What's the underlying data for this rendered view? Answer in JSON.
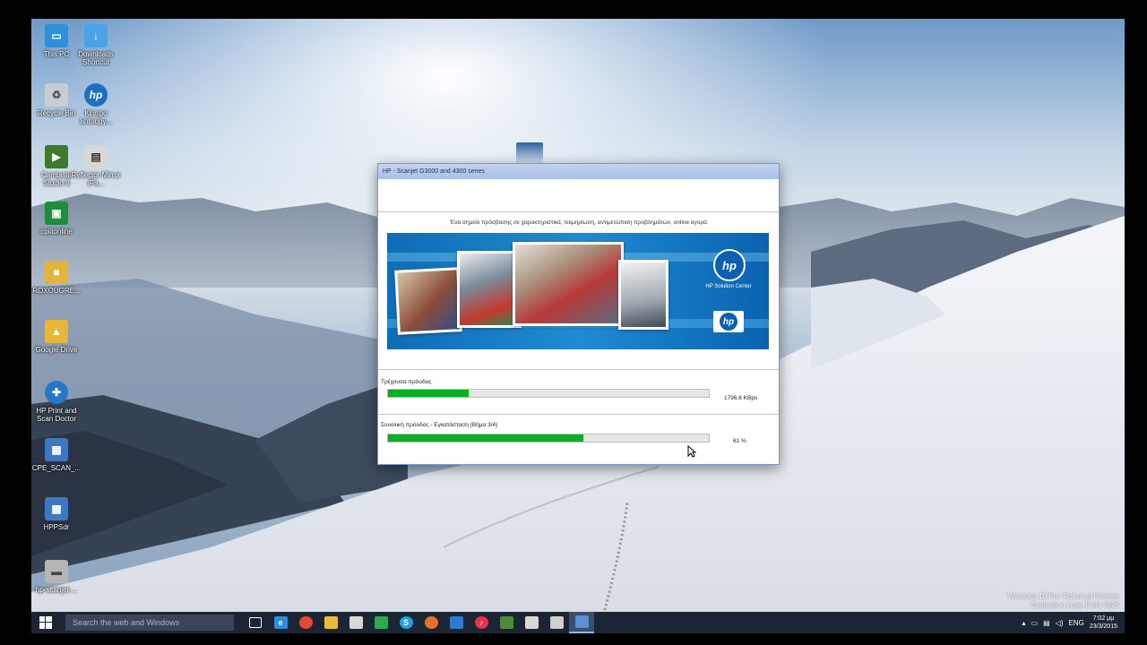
{
  "desktop": {
    "icons": [
      {
        "label": "This PC",
        "glyph": "pc-icon",
        "color": "#2f8fd8"
      },
      {
        "label": "Downloads Shortcut",
        "glyph": "downloads-shortcut-icon",
        "color": "#4aa3e8"
      },
      {
        "label": "Recycle Bin",
        "glyph": "recycle-bin-icon",
        "color": "#c8ccd3"
      },
      {
        "label": "Κέντρο λειτουργ...",
        "glyph": "hp-icon",
        "color": "#1f6fc0"
      },
      {
        "label": "Camtasia Studio 8",
        "glyph": "camtasia-icon",
        "color": "#3d7a2c"
      },
      {
        "label": "Reflector Mirror iPa...",
        "glyph": "reflector-icon",
        "color": "#d8d8d8"
      },
      {
        "label": "cpiitonline",
        "glyph": "cpiitonline-icon",
        "color": "#1e8c3a"
      },
      {
        "label": "ROXOUGRE...",
        "glyph": "folder-icon",
        "color": "#e3b43a"
      },
      {
        "label": "Google Drive",
        "glyph": "google-drive-icon",
        "color": "#e7b63b"
      },
      {
        "label": "HP Print and Scan Doctor",
        "glyph": "hp-print-scan-doctor-icon",
        "color": "#2777c8"
      },
      {
        "label": "CPE_SCAN_...",
        "glyph": "scan-app-icon",
        "color": "#3f77c2"
      },
      {
        "label": "HPPSdr",
        "glyph": "hppsdr-icon",
        "color": "#3f77c2"
      },
      {
        "label": "hp-scanjet-...",
        "glyph": "scanner-icon",
        "color": "#b5b5b5"
      }
    ],
    "watermark": {
      "line1": "Windows 10 Pro Technical Preview",
      "line2": "Evaluation copy. Build 9926"
    }
  },
  "dialog": {
    "title": "HP - Scanjet G3000 and 4300 series",
    "tagline": "Ένα σημείο πρόσβασης σε χαρακτηριστικά, τεκμηρίωση, αντιμετώπιση προβλημάτων, online αγορά",
    "banner": {
      "solution_label": "HP Solution Center",
      "logo_text": "hp"
    },
    "current_progress": {
      "label": "Τρέχουσα πρόοδος",
      "fraction": 0.25,
      "value_text": "1796.6 KBps"
    },
    "overall_progress": {
      "label": "Συνολική πρόοδος - Εγκατάσταση (Βήμα 3/4)",
      "fraction": 0.61,
      "value_text": "61 %"
    }
  },
  "taskbar": {
    "search_placeholder": "Search the web and Windows",
    "apps": [
      {
        "name": "task-view-icon",
        "color": "#ffffff",
        "glyph": ""
      },
      {
        "name": "internet-explorer-icon",
        "color": "#2a8de0",
        "glyph": "e"
      },
      {
        "name": "chrome-icon",
        "color": "#e34a33",
        "glyph": ""
      },
      {
        "name": "file-explorer-icon",
        "color": "#e8bb3f",
        "glyph": ""
      },
      {
        "name": "store-icon",
        "color": "#d8d8d8",
        "glyph": ""
      },
      {
        "name": "google-drive-taskbar-icon",
        "color": "#2fa84f",
        "glyph": ""
      },
      {
        "name": "skype-icon",
        "color": "#1ca3e6",
        "glyph": "S"
      },
      {
        "name": "firefox-icon",
        "color": "#e7702a",
        "glyph": ""
      },
      {
        "name": "scan-taskbar-icon",
        "color": "#2d7ad0",
        "glyph": ""
      },
      {
        "name": "itunes-icon",
        "color": "#e2344b",
        "glyph": "♪"
      },
      {
        "name": "camtasia-taskbar-icon",
        "color": "#4d8a3a",
        "glyph": ""
      },
      {
        "name": "recorder-taskbar-icon",
        "color": "#d8d8d8",
        "glyph": ""
      },
      {
        "name": "device-taskbar-icon",
        "color": "#cfcfcf",
        "glyph": ""
      },
      {
        "name": "hp-setup-taskbar-icon",
        "color": "#5a8fd6",
        "glyph": ""
      }
    ],
    "tray": {
      "language": "ENG",
      "time": "7:02 μμ",
      "date": "23/3/2015"
    }
  }
}
